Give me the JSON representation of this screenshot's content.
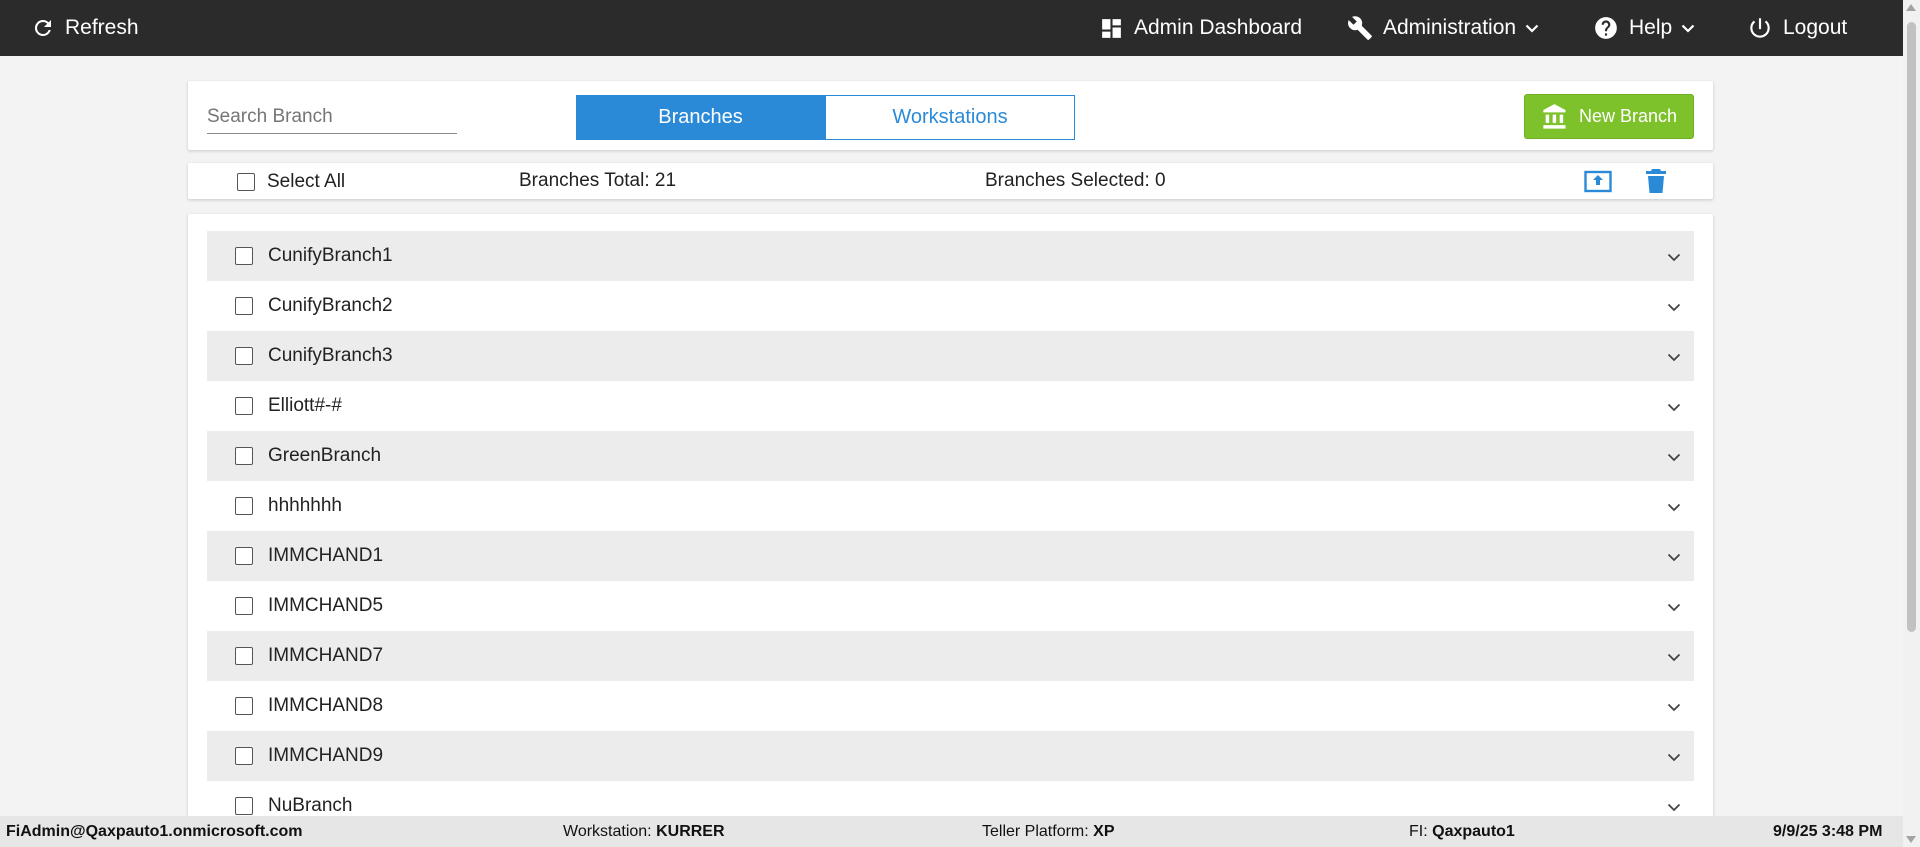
{
  "topbar": {
    "refresh_label": "Refresh",
    "admin_dashboard_label": "Admin Dashboard",
    "administration_label": "Administration",
    "help_label": "Help",
    "logout_label": "Logout"
  },
  "search": {
    "placeholder": "Search Branch",
    "value": ""
  },
  "tabs": {
    "branches_label": "Branches",
    "workstations_label": "Workstations",
    "active": "Branches"
  },
  "new_branch_label": "New Branch",
  "status": {
    "select_all_label": "Select All",
    "branches_total": "Branches Total: 21",
    "branches_selected": "Branches Selected: 0"
  },
  "branches": [
    "CunifyBranch1",
    "CunifyBranch2",
    "CunifyBranch3",
    "Elliott#-#",
    "GreenBranch",
    "hhhhhhh",
    "IMMCHAND1",
    "IMMCHAND5",
    "IMMCHAND7",
    "IMMCHAND8",
    "IMMCHAND9",
    "NuBranch"
  ],
  "footer": {
    "user": "FiAdmin@Qaxpauto1.onmicrosoft.com",
    "workstation_label": "Workstation:",
    "workstation_value": "KURRER",
    "platform_label": "Teller Platform:",
    "platform_value": "XP",
    "fi_label": "FI:",
    "fi_value": "Qaxpauto1",
    "datetime": "9/9/25 3:48 PM"
  },
  "colors": {
    "topbar_bg": "#2b2b2b",
    "accent_blue": "#2b8ad8",
    "new_branch_green": "#7dc12b",
    "row_alt": "#ececec"
  }
}
